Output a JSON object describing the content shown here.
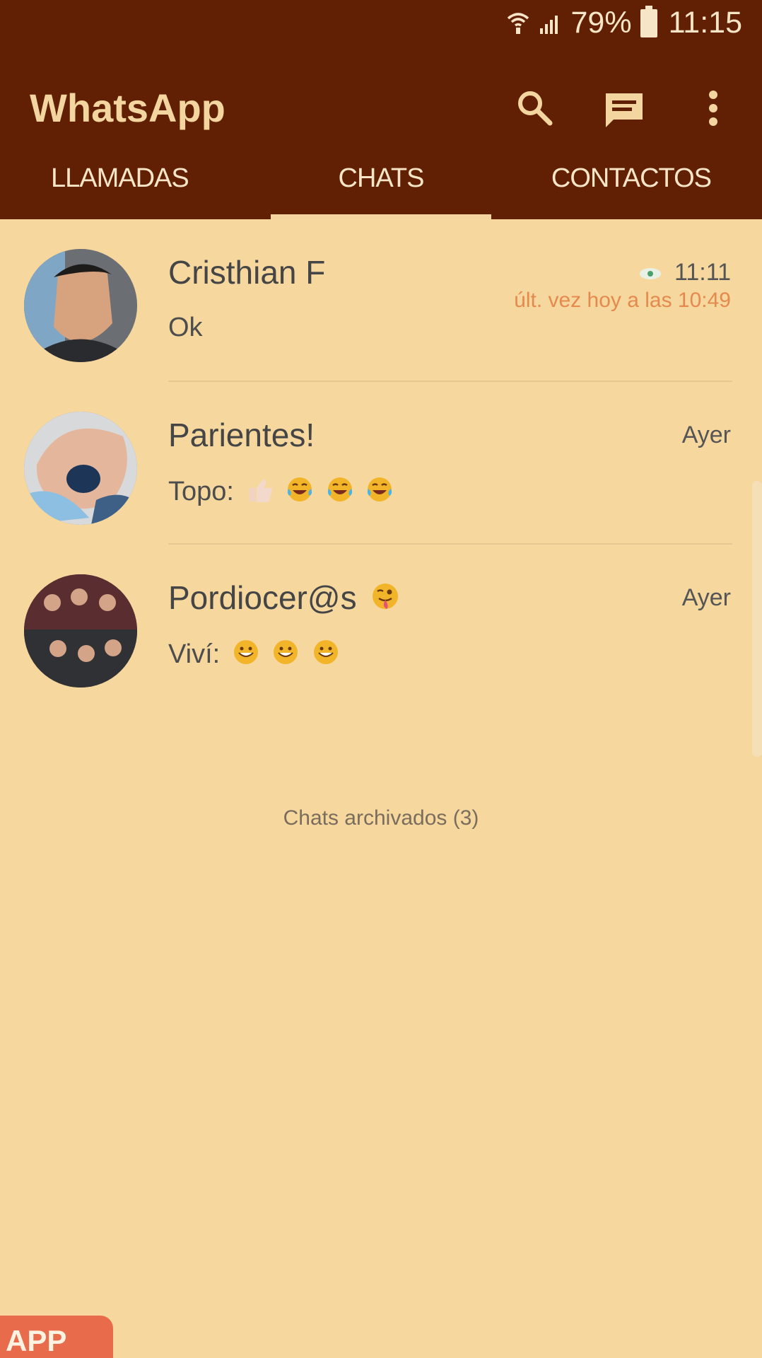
{
  "status": {
    "battery_percent": "79%",
    "time": "11:15",
    "icons": [
      "wifi-icon",
      "signal-icon",
      "battery-icon"
    ]
  },
  "app": {
    "title": "WhatsApp",
    "actions": [
      "search-icon",
      "new-chat-icon",
      "more-icon"
    ]
  },
  "tabs": [
    {
      "label": "LLAMADAS"
    },
    {
      "label": "CHATS",
      "active": true
    },
    {
      "label": "CONTACTOS"
    }
  ],
  "chats": [
    {
      "name": "Cristhian F",
      "preview": "Ok",
      "time": "11:11",
      "last_seen": "últ. vez hoy a las 10:49",
      "status_icon": "eye-icon"
    },
    {
      "name": "Parientes!",
      "preview": "Topo:",
      "time": "Ayer",
      "emojis": [
        "thumbs-up",
        "tears-of-joy",
        "tears-of-joy",
        "tears-of-joy"
      ]
    },
    {
      "name": "Pordiocer@s",
      "preview": "Viví:",
      "time": "Ayer",
      "name_emoji": "winking-face-with-tongue",
      "emojis": [
        "grinning-face",
        "grinning-face",
        "grinning-face"
      ]
    }
  ],
  "archived": "Chats archivados (3)",
  "bottom_chip": "APP",
  "colors": {
    "header": "#612003",
    "accent": "#f3d59f",
    "background": "#f6d89f",
    "last_seen": "#e58a4e"
  }
}
